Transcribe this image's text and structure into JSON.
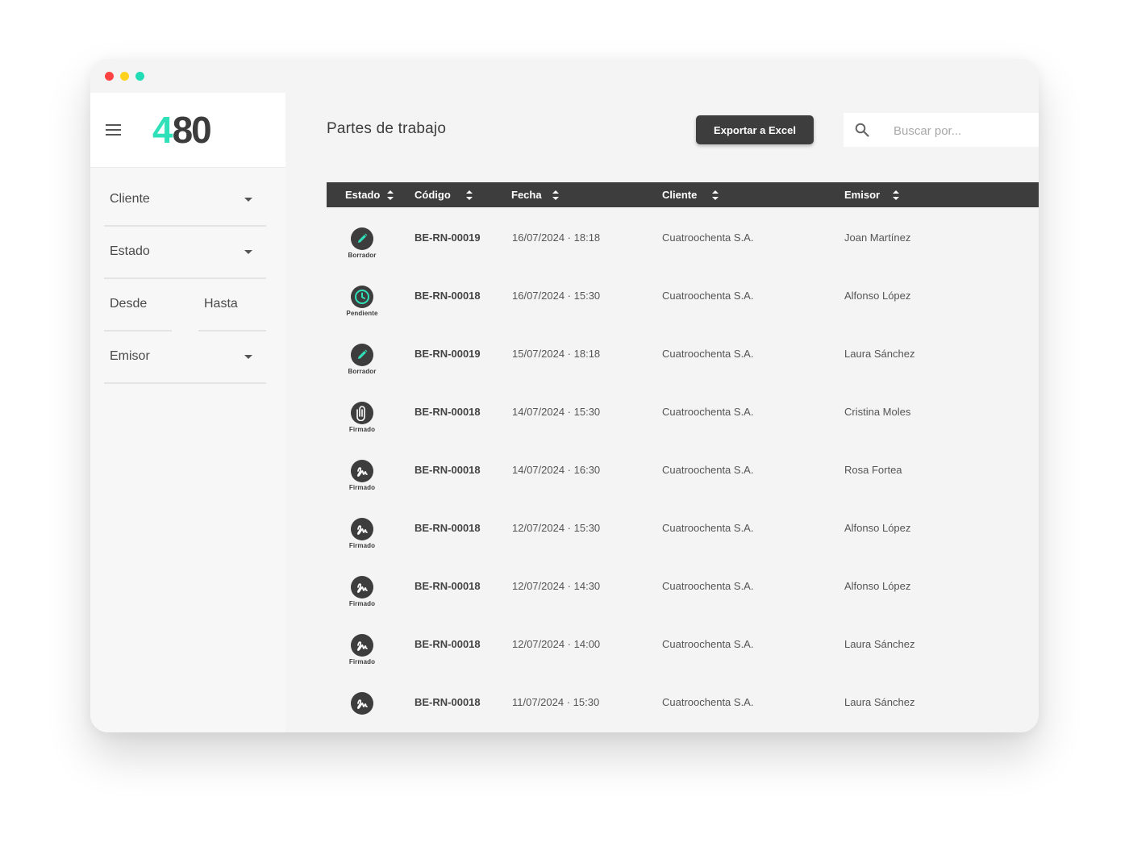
{
  "logo": {
    "four": "4",
    "rest": "80"
  },
  "sidebar": {
    "filters": {
      "cliente": "Cliente",
      "estado": "Estado",
      "desde": "Desde",
      "hasta": "Hasta",
      "emisor": "Emisor"
    }
  },
  "header": {
    "title": "Partes de trabajo",
    "export_label": "Exportar a Excel",
    "search_placeholder": "Buscar por..."
  },
  "table": {
    "columns": [
      "Estado",
      "Código",
      "Fecha",
      "Cliente",
      "Emisor"
    ],
    "rows": [
      {
        "status": "Borrador",
        "icon": "pencil-icon",
        "code": "BE-RN-00019",
        "date": "16/07/2024 · 18:18",
        "client": "Cuatroochenta S.A.",
        "issuer": "Joan Martínez"
      },
      {
        "status": "Pendiente",
        "icon": "clock-icon",
        "code": "BE-RN-00018",
        "date": "16/07/2024 · 15:30",
        "client": "Cuatroochenta S.A.",
        "issuer": "Alfonso López"
      },
      {
        "status": "Borrador",
        "icon": "pencil-icon",
        "code": "BE-RN-00019",
        "date": "15/07/2024 · 18:18",
        "client": "Cuatroochenta S.A.",
        "issuer": "Laura Sánchez"
      },
      {
        "status": "Firmado",
        "icon": "paperclip-icon",
        "code": "BE-RN-00018",
        "date": "14/07/2024 · 15:30",
        "client": "Cuatroochenta S.A.",
        "issuer": "Cristina Moles"
      },
      {
        "status": "Firmado",
        "icon": "signature-icon",
        "code": "BE-RN-00018",
        "date": "14/07/2024 · 16:30",
        "client": "Cuatroochenta S.A.",
        "issuer": "Rosa Fortea"
      },
      {
        "status": "Firmado",
        "icon": "signature-icon",
        "code": "BE-RN-00018",
        "date": "12/07/2024 · 15:30",
        "client": "Cuatroochenta S.A.",
        "issuer": "Alfonso López"
      },
      {
        "status": "Firmado",
        "icon": "signature-icon",
        "code": "BE-RN-00018",
        "date": "12/07/2024 · 14:30",
        "client": "Cuatroochenta S.A.",
        "issuer": "Alfonso López"
      },
      {
        "status": "Firmado",
        "icon": "signature-icon",
        "code": "BE-RN-00018",
        "date": "12/07/2024 · 14:00",
        "client": "Cuatroochenta S.A.",
        "issuer": "Laura Sánchez"
      },
      {
        "status": "",
        "icon": "signature-icon",
        "code": "BE-RN-00018",
        "date": "11/07/2024 · 15:30",
        "client": "Cuatroochenta S.A.",
        "issuer": "Laura Sánchez"
      }
    ]
  },
  "colors": {
    "accent": "#2fe0b9",
    "dark": "#3d3d3d",
    "background": "#f4f4f4"
  }
}
